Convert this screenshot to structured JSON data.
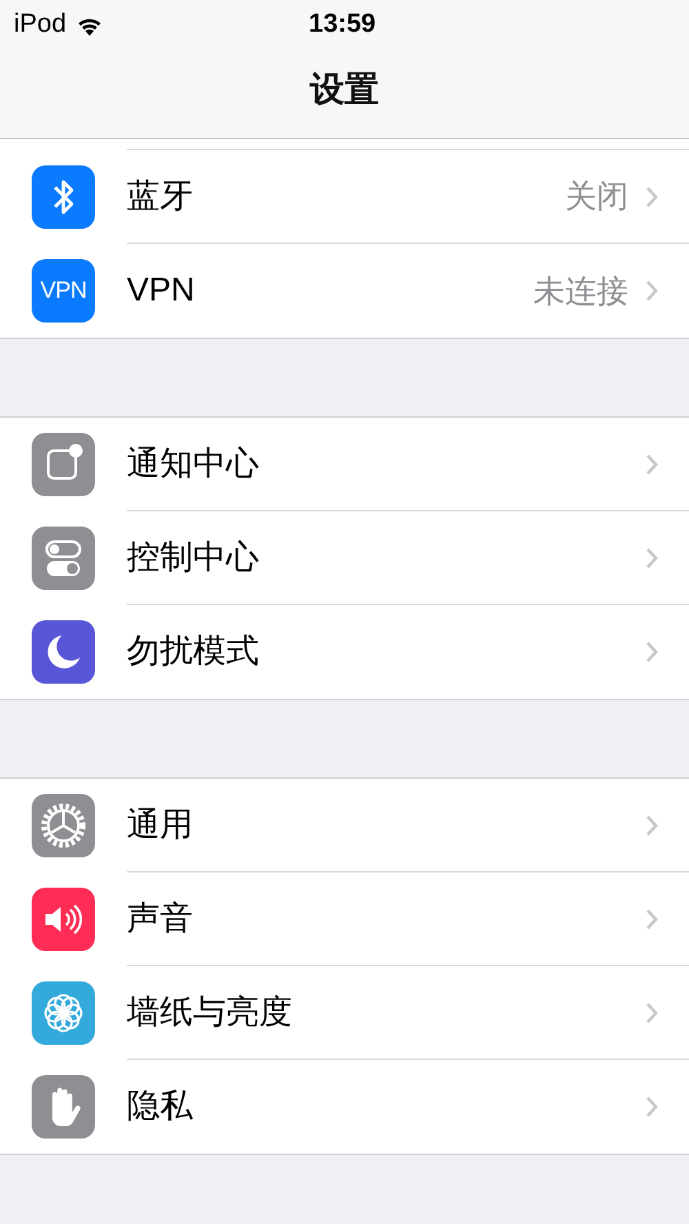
{
  "status_bar": {
    "carrier": "iPod",
    "time": "13:59"
  },
  "nav": {
    "title": "设置"
  },
  "groups": [
    {
      "rows": [
        {
          "label": "蓝牙",
          "value": "关闭",
          "color": "#0a7bff"
        },
        {
          "label": "VPN",
          "value": "未连接",
          "color": "#0a7bff",
          "icon_text": "VPN"
        }
      ]
    },
    {
      "rows": [
        {
          "label": "通知中心",
          "color": "#8e8e93"
        },
        {
          "label": "控制中心",
          "color": "#8e8e93"
        },
        {
          "label": "勿扰模式",
          "color": "#5856d6"
        }
      ]
    },
    {
      "rows": [
        {
          "label": "通用",
          "color": "#8e8e93"
        },
        {
          "label": "声音",
          "color": "#ff2d55"
        },
        {
          "label": "墙纸与亮度",
          "color": "#34aadc"
        },
        {
          "label": "隐私",
          "color": "#8e8e93"
        }
      ]
    }
  ]
}
